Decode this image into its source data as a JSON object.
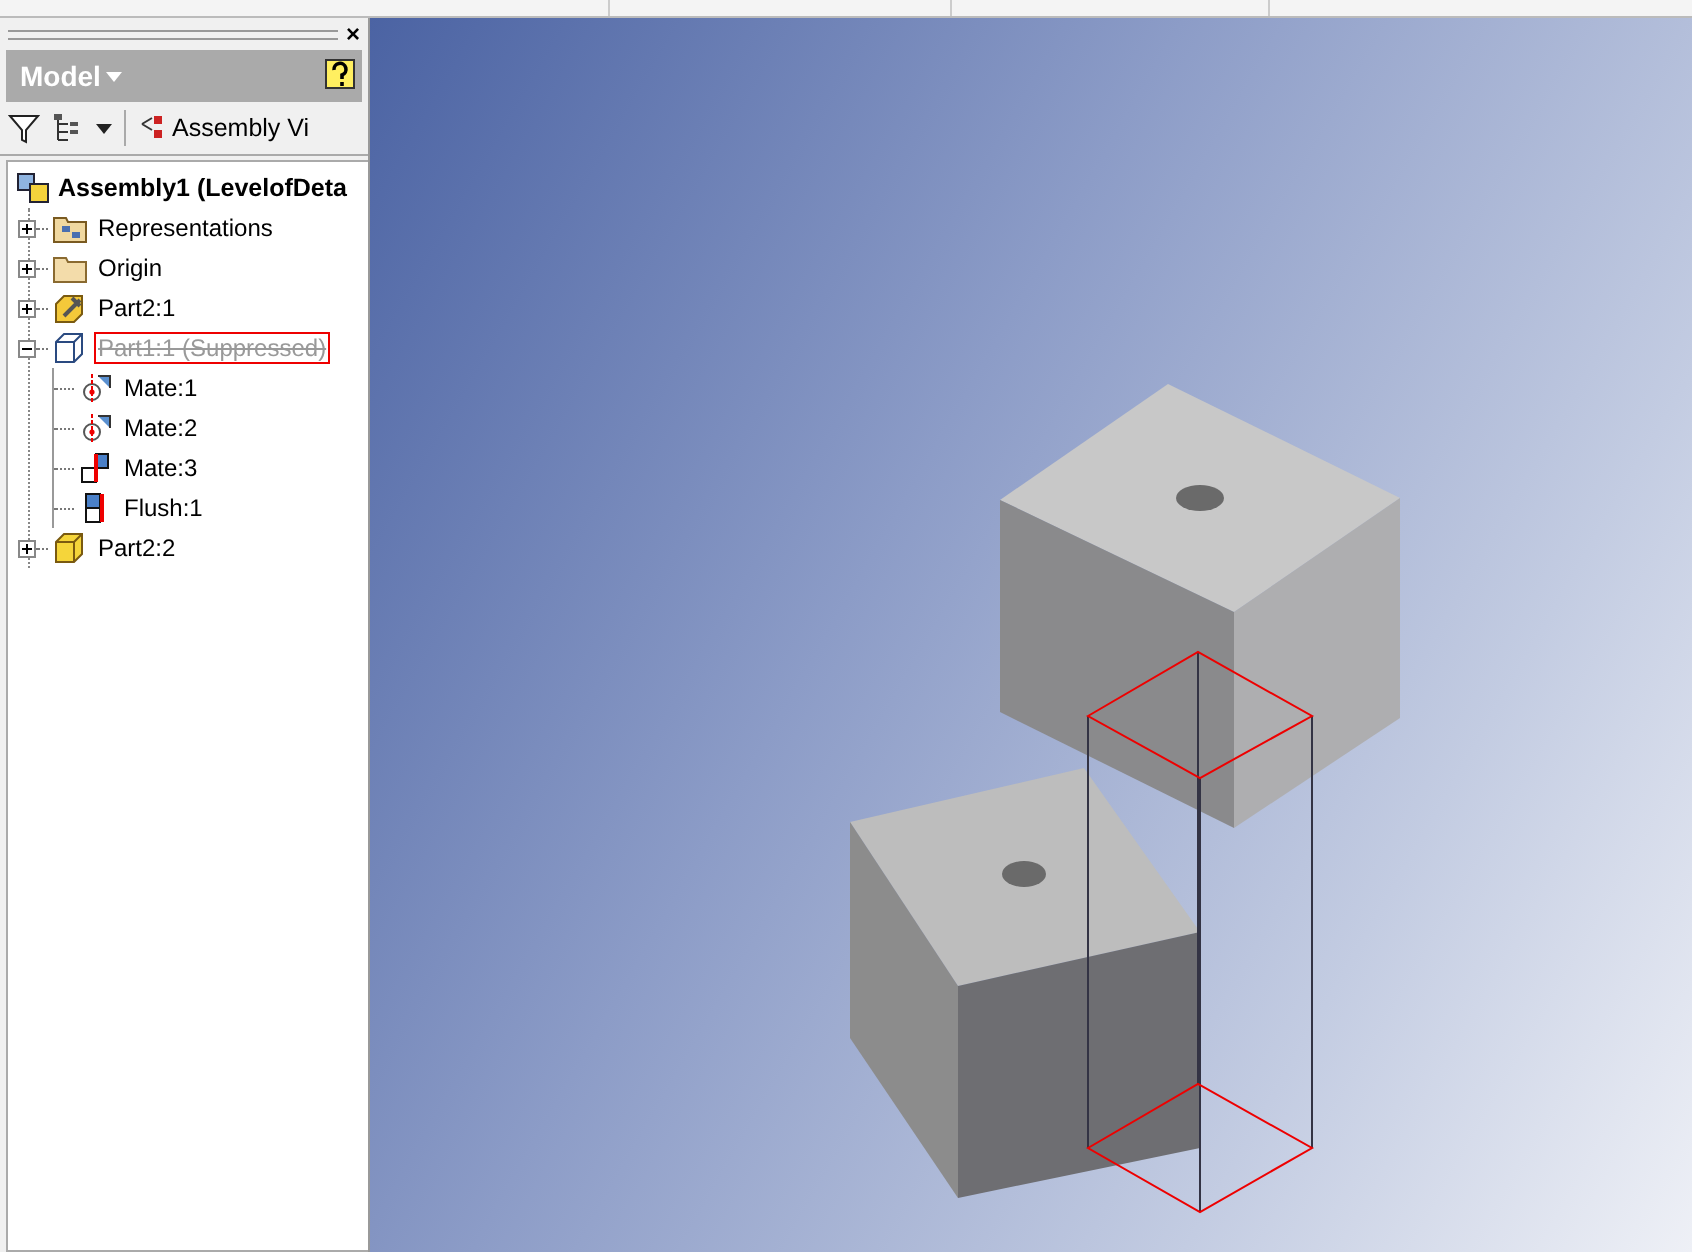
{
  "panel": {
    "close": "×",
    "title": "Model",
    "toolbar_button": "Assembly Vi"
  },
  "tree": {
    "label": "Assembly1 (LevelofDeta",
    "kind": "assembly",
    "children": [
      {
        "label": "Representations",
        "kind": "representations",
        "expanded": false,
        "suppressed": false,
        "selected": false
      },
      {
        "label": "Origin",
        "kind": "folder",
        "expanded": false,
        "suppressed": false,
        "selected": false
      },
      {
        "label": "Part2:1",
        "kind": "part-grounded",
        "expanded": false,
        "suppressed": false,
        "selected": false
      },
      {
        "label": "Part1:1 (Suppressed)",
        "kind": "part-suppressed",
        "expanded": true,
        "suppressed": true,
        "selected": true,
        "children": [
          {
            "label": "Mate:1",
            "kind": "mate-circle",
            "suppressed": false,
            "selected": false
          },
          {
            "label": "Mate:2",
            "kind": "mate-circle",
            "suppressed": false,
            "selected": false
          },
          {
            "label": "Mate:3",
            "kind": "mate-flat",
            "suppressed": false,
            "selected": false
          },
          {
            "label": "Flush:1",
            "kind": "flush",
            "suppressed": false,
            "selected": false
          }
        ]
      },
      {
        "label": "Part2:2",
        "kind": "part",
        "expanded": false,
        "suppressed": false,
        "selected": false
      }
    ]
  }
}
